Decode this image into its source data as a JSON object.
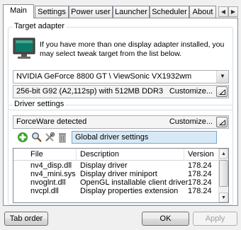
{
  "tabs": [
    {
      "label": "Main",
      "active": true
    },
    {
      "label": "Settings",
      "active": false
    },
    {
      "label": "Power user",
      "active": false
    },
    {
      "label": "Launcher",
      "active": false
    },
    {
      "label": "Scheduler",
      "active": false
    },
    {
      "label": "About",
      "active": false
    }
  ],
  "tab_scroll": {
    "left": "◀",
    "right": "▶"
  },
  "target_adapter": {
    "title": "Target adapter",
    "description": "If you have more than one display adapter installed, you may select tweak target from the list below.",
    "selected_adapter": "NVIDIA GeForce 8800 GT  \\ ViewSonic VX1932wm",
    "adapter_info": "256-bit G92 (A2,112sp) with 512MB DDR3",
    "customize_label": "Customize..."
  },
  "driver_settings": {
    "title": "Driver settings",
    "driver_info": "ForceWare detected",
    "customize_label": "Customize...",
    "profile_name": "Global driver settings",
    "columns": [
      "File",
      "Description",
      "Version"
    ],
    "rows": [
      {
        "file": "nv4_disp.dll",
        "description": "Display driver",
        "version": "178.24"
      },
      {
        "file": "nv4_mini.sys",
        "description": "Display driver miniport",
        "version": "178.24"
      },
      {
        "file": "nvoglnt.dll",
        "description": "OpenGL installable client driver",
        "version": "178.24"
      },
      {
        "file": "nvcpl.dll",
        "description": "Display properties extension",
        "version": "178.24"
      }
    ]
  },
  "buttons": {
    "tab_order": "Tab order",
    "ok": "OK",
    "apply": "Apply"
  },
  "icons": [
    "monitor-icon",
    "add-icon",
    "search-icon",
    "tools-icon",
    "delete-icon"
  ]
}
